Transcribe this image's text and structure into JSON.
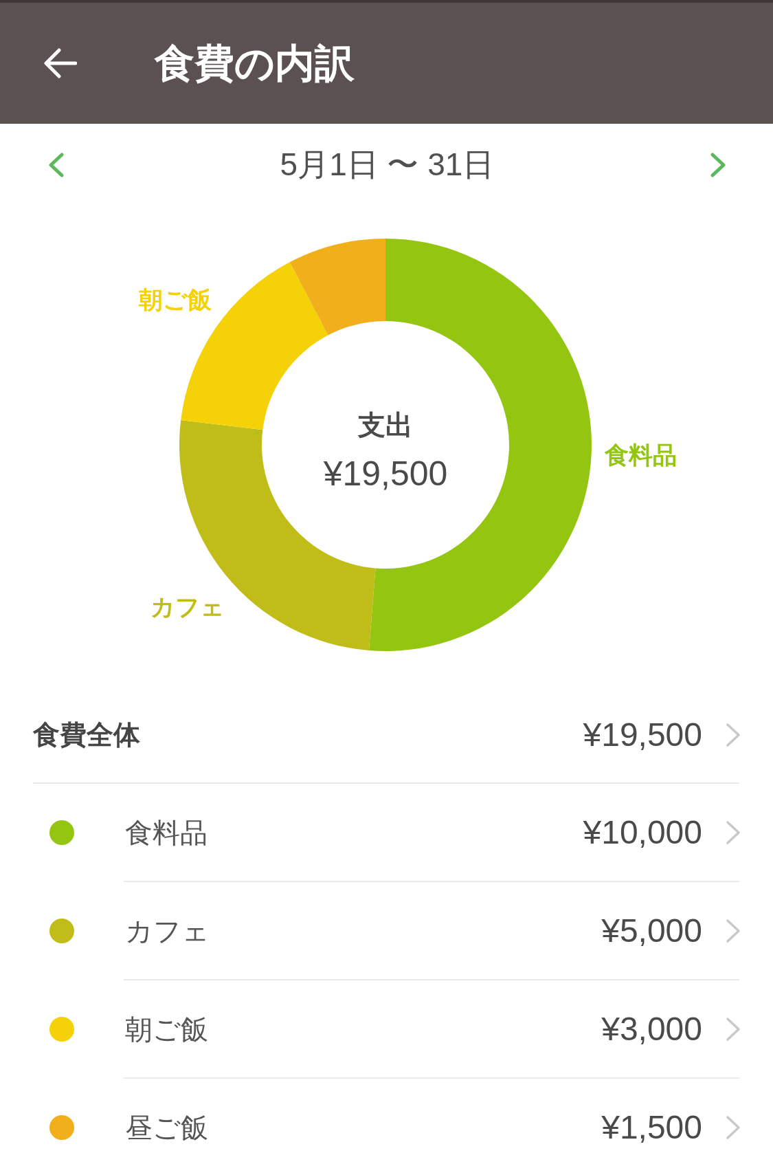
{
  "app_bar": {
    "title": "食費の内訳"
  },
  "period": {
    "label": "5月1日 〜 31日"
  },
  "donut": {
    "center_label": "支出",
    "center_value": "¥19,500",
    "chart_data": {
      "type": "donut",
      "categories": [
        "食料品",
        "カフェ",
        "朝ご飯",
        null
      ],
      "values": [
        51.28,
        25.64,
        15.39,
        7.69
      ]
    }
  },
  "summary": {
    "label": "食費全体",
    "amount": "¥19,500"
  },
  "categories": [
    {
      "name": "食料品",
      "amount": "¥10,000",
      "color": "#93c511"
    },
    {
      "name": "カフェ",
      "amount": "¥5,000",
      "color": "#c0bc18"
    },
    {
      "name": "朝ご飯",
      "amount": "¥3,000",
      "color": "#f5d108"
    },
    {
      "name": "昼ご飯",
      "amount": "¥1,500",
      "color": "#f2af1c"
    }
  ]
}
